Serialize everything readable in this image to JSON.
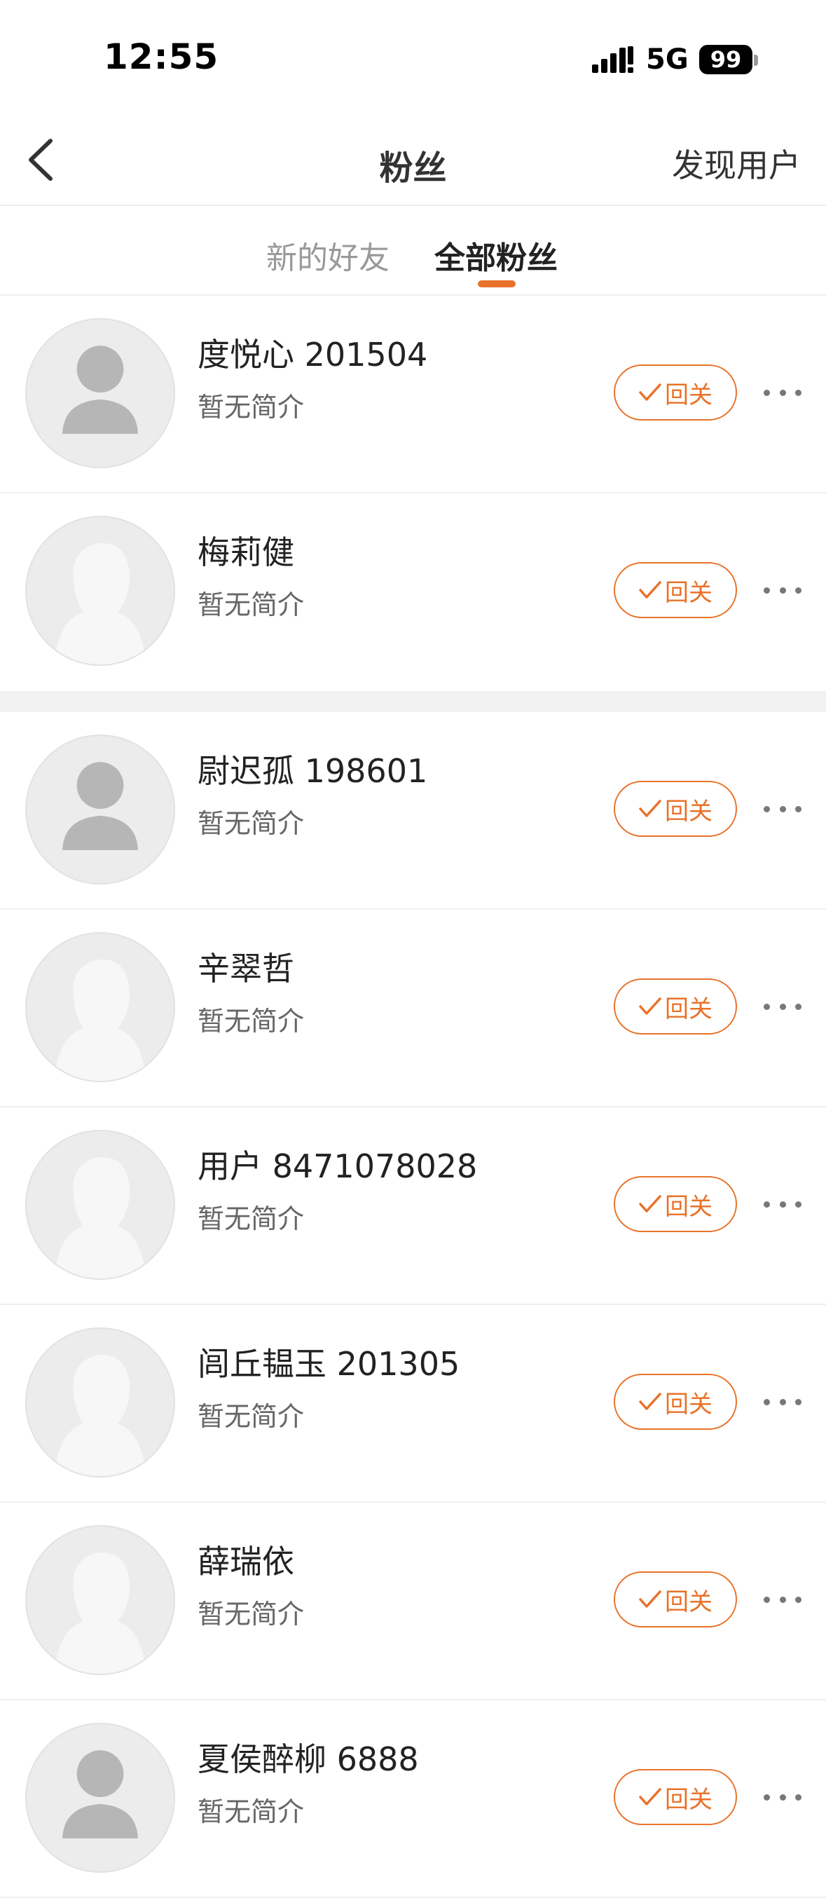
{
  "status_bar": {
    "time": "12:55",
    "network": "5G",
    "battery": "99"
  },
  "nav": {
    "title": "粉丝",
    "discover_label": "发现用户"
  },
  "tabs": [
    {
      "label": "新的好友",
      "active": false
    },
    {
      "label": "全部粉丝",
      "active": true
    }
  ],
  "accent_color": "#e8722a",
  "users": [
    {
      "name": "度悦心 201504",
      "bio": "暂无简介",
      "follow_label": "回关",
      "avatar_icon": "default-avatar-dark-icon"
    },
    {
      "name": "梅莉健",
      "bio": "暂无简介",
      "follow_label": "回关",
      "avatar_icon": "default-avatar-light-icon"
    },
    {
      "name": "尉迟孤 198601",
      "bio": "暂无简介",
      "follow_label": "回关",
      "avatar_icon": "default-avatar-dark-icon"
    },
    {
      "name": "辛翠哲",
      "bio": "暂无简介",
      "follow_label": "回关",
      "avatar_icon": "default-avatar-light-icon"
    },
    {
      "name": "用户 8471078028",
      "bio": "暂无简介",
      "follow_label": "回关",
      "avatar_icon": "default-avatar-light-icon"
    },
    {
      "name": "闾丘韫玉 201305",
      "bio": "暂无简介",
      "follow_label": "回关",
      "avatar_icon": "default-avatar-light-icon"
    },
    {
      "name": "薛瑞依",
      "bio": "暂无简介",
      "follow_label": "回关",
      "avatar_icon": "default-avatar-light-icon"
    },
    {
      "name": "夏侯醉柳 6888",
      "bio": "暂无简介",
      "follow_label": "回关",
      "avatar_icon": "default-avatar-dark-icon"
    }
  ]
}
